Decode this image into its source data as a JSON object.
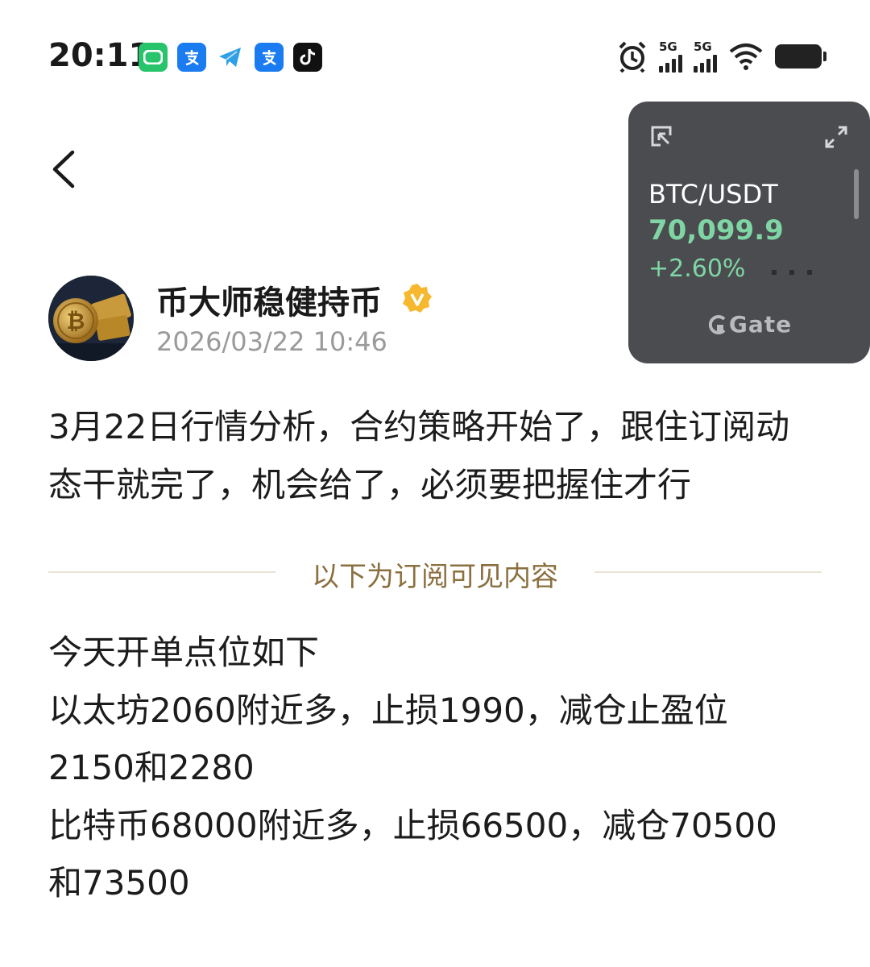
{
  "status_bar": {
    "time": "20:11",
    "app_icons": [
      "message-icon",
      "alipay-icon",
      "telegram-icon",
      "alipay-icon",
      "tiktok-icon"
    ],
    "signal_label_1": "5G",
    "signal_label_2": "5G",
    "system_icons": [
      "alarm-icon",
      "signal-icon",
      "signal-icon",
      "wifi-icon",
      "battery-icon"
    ]
  },
  "widget": {
    "pair": "BTC/USDT",
    "price": "70,099.9",
    "change": "+2.60%",
    "brand": "Gate",
    "more": "...",
    "price_color": "#7fd6a4"
  },
  "post": {
    "author": "币大师稳健持币",
    "date": "2026/03/22 10:46",
    "text": "3月22日行情分析，合约策略开始了，跟住订阅动态干就完了，机会给了，必须要把握住才行",
    "divider_label": "以下为订阅可见内容",
    "subscription_lines": [
      "今天开单点位如下",
      "以太坊2060附近多，止损1990，减仓止盈位",
      "2150和2280",
      "比特币68000附近多，止损66500，减仓70500",
      "和73500"
    ]
  },
  "colors": {
    "accent_gold": "#8b6f3f",
    "verified": "#f5b82e",
    "widget_bg": "#4a4c50"
  }
}
